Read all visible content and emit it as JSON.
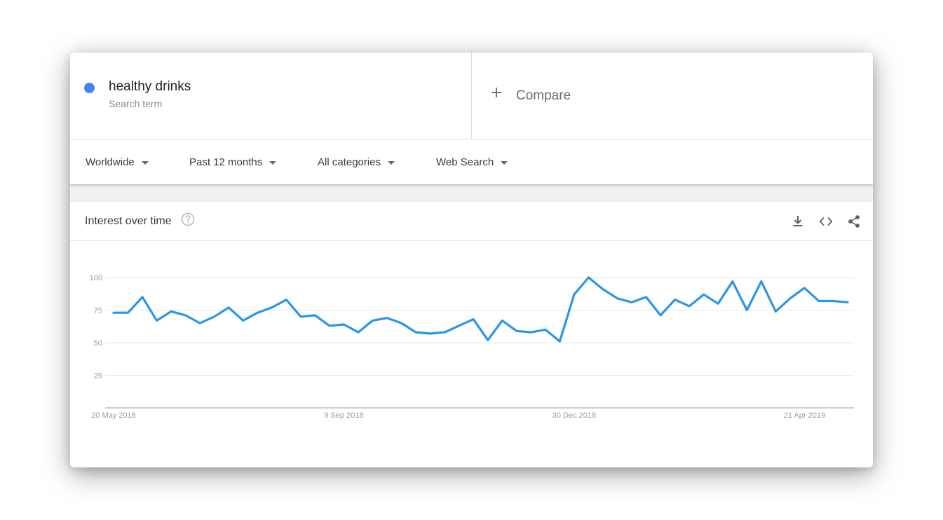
{
  "search_term": {
    "name": "healthy drinks",
    "subtitle": "Search term",
    "color": "#4285f4"
  },
  "compare": {
    "label": "Compare",
    "icon": "plus-icon"
  },
  "filters": [
    {
      "label": "Worldwide"
    },
    {
      "label": "Past 12 months"
    },
    {
      "label": "All categories"
    },
    {
      "label": "Web Search"
    }
  ],
  "panel": {
    "title": "Interest over time",
    "help_icon": "help-icon",
    "actions": [
      "download-icon",
      "embed-icon",
      "share-icon"
    ]
  },
  "colors": {
    "line": "#2b96e8",
    "grid": "#e6e6e6",
    "axis": "#9e9e9e",
    "tick_text": "#9a9a9a"
  },
  "chart_data": {
    "type": "line",
    "title": "",
    "xlabel": "",
    "ylabel": "",
    "ylim": [
      0,
      100
    ],
    "yticks": [
      25,
      50,
      75,
      100
    ],
    "grid": true,
    "x_tick_labels": [
      "20 May 2018",
      "9 Sep 2018",
      "30 Dec 2018",
      "21 Apr 2019"
    ],
    "x_tick_index": [
      0,
      16,
      32,
      48
    ],
    "series": [
      {
        "values": [
          73,
          73,
          85,
          67,
          74,
          71,
          65,
          70,
          77,
          67,
          73,
          77,
          83,
          70,
          71,
          63,
          64,
          58,
          67,
          69,
          65,
          58,
          57,
          58,
          63,
          68,
          52,
          67,
          59,
          58,
          60,
          51,
          87,
          100,
          91,
          84,
          81,
          85,
          71,
          83,
          78,
          87,
          80,
          97,
          75,
          97,
          74,
          84,
          92,
          82,
          82,
          81
        ]
      }
    ]
  }
}
